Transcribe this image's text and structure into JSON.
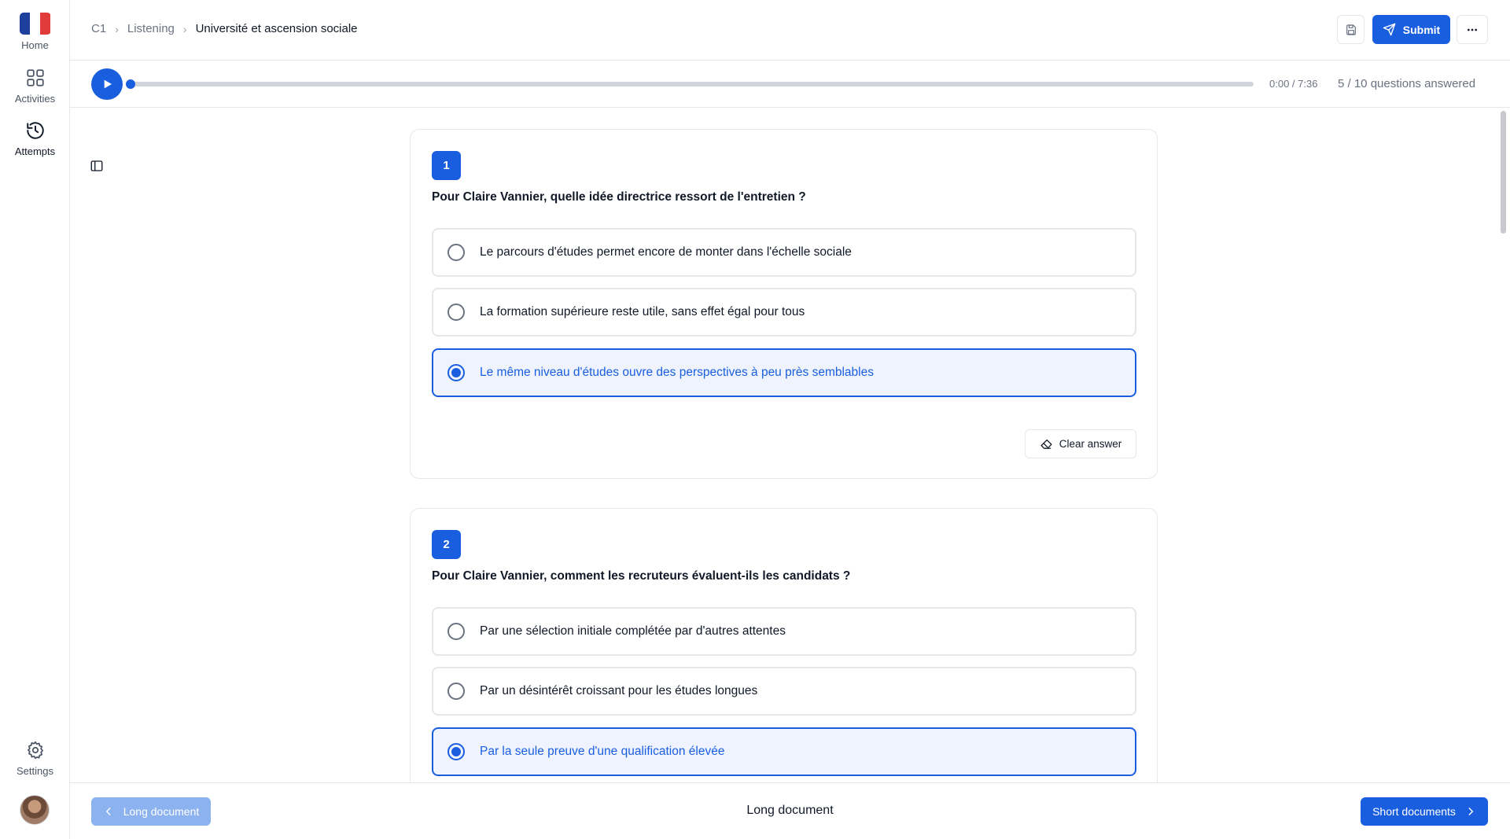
{
  "sidebar": {
    "items": [
      {
        "label": "Home",
        "icon": "france-flag-icon"
      },
      {
        "label": "Activities",
        "icon": "grid-icon"
      },
      {
        "label": "Attempts",
        "icon": "history-icon"
      },
      {
        "label": "Settings",
        "icon": "gear-icon"
      }
    ],
    "flag_colors": [
      "#1f3f9c",
      "#ffffff",
      "#e23b3b"
    ]
  },
  "header": {
    "breadcrumb": [
      "C1",
      "Listening",
      "Université et ascension sociale"
    ],
    "submit_label": "Submit"
  },
  "audio": {
    "time": "0:00 / 7:36",
    "progress_fraction": 0.0,
    "answered": "5 / 10 questions answered"
  },
  "questions": [
    {
      "number": "1",
      "text": "Pour Claire Vannier, quelle idée directrice ressort de l'entretien ?",
      "options": [
        "Le parcours d'études permet encore de monter dans l'échelle sociale",
        "La formation supérieure reste utile, sans effet égal pour tous",
        "Le même niveau d'études ouvre des perspectives à peu près semblables"
      ],
      "selected": 2,
      "clear_label": "Clear answer"
    },
    {
      "number": "2",
      "text": "Pour Claire Vannier, comment les recruteurs évaluent-ils les candidats ?",
      "options": [
        "Par une sélection initiale complétée par d'autres attentes",
        "Par un désintérêt croissant pour les études longues",
        "Par la seule preuve d'une qualification élevée"
      ],
      "selected": 2
    }
  ],
  "footer": {
    "prev_label": "Long document",
    "title": "Long document",
    "next_label": "Short documents"
  },
  "colors": {
    "accent": "#1a5ee0",
    "accent_light": "#eef3fd",
    "border": "#e5e7eb"
  }
}
